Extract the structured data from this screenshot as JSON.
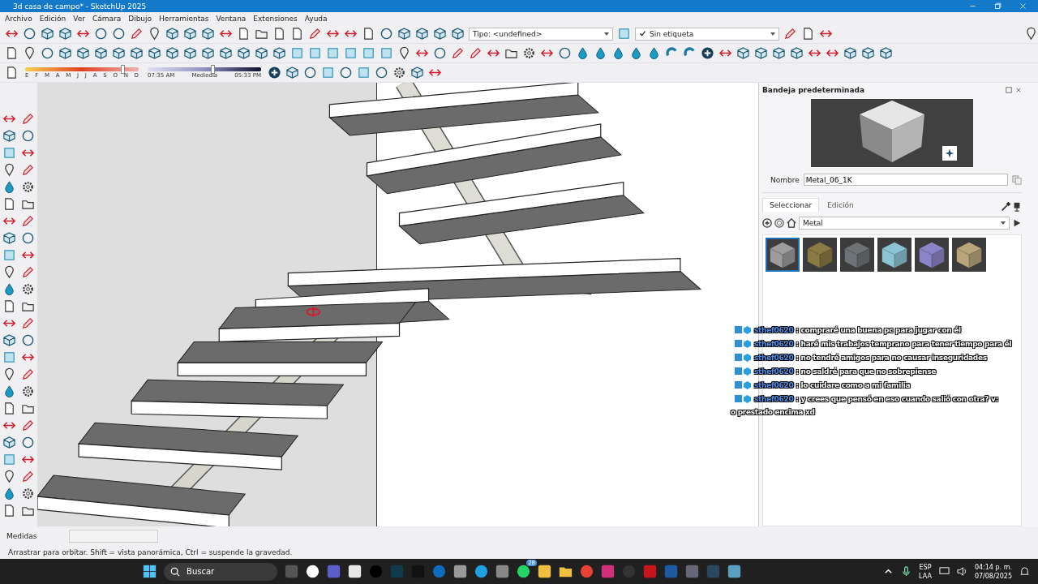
{
  "window": {
    "title": "3d casa de campo* - SketchUp 2025"
  },
  "menu": [
    "Archivo",
    "Edición",
    "Ver",
    "Cámara",
    "Dibujo",
    "Herramientas",
    "Ventana",
    "Extensiones",
    "Ayuda"
  ],
  "toolbar": {
    "type_dropdown": "Tipo: <undefined>",
    "tag_dropdown": "Sin etiqueta"
  },
  "shadows": {
    "months": [
      "E",
      "F",
      "M",
      "A",
      "M",
      "J",
      "J",
      "A",
      "S",
      "O",
      "N",
      "D"
    ],
    "month_slider": {
      "level": 0.86
    },
    "times": [
      "07:35 AM",
      "Mediodia",
      "05:33 PM"
    ],
    "time_slider": {
      "level": 0.57
    }
  },
  "chat": {
    "messages": [
      {
        "user": "sthef0620",
        "text": ": compraré una buena pc para jugar con él"
      },
      {
        "user": "sthef0620",
        "text": ": haré mis trabajos temprano para tener tiempo para él"
      },
      {
        "user": "sthef0620",
        "text": ": no tendré amigos para no causar inseguridades"
      },
      {
        "user": "sthef0620",
        "text": ": no saldré para que no sobrepiense"
      },
      {
        "user": "sthef0620",
        "text": ": lo cuidare como a mi familia"
      },
      {
        "user": "sthef0620",
        "text": ": y crees que pensó en eso cuando salió con otra? v:"
      }
    ],
    "partial_line": "o prestado encima xd"
  },
  "tray": {
    "title": "Bandeja predeterminada",
    "name_label": "Nombre",
    "name_value": "Metal_06_1K",
    "tabs": [
      {
        "label": "Seleccionar",
        "selected": true
      },
      {
        "label": "Edición",
        "selected": false
      }
    ],
    "library": "Metal",
    "materials": [
      {
        "color": "#9c9c9c",
        "selected": true
      },
      {
        "color": "#8a7a45",
        "selected": false
      },
      {
        "color": "#6d7377",
        "selected": false
      },
      {
        "color": "#8cc4d4",
        "selected": false
      },
      {
        "color": "#8c84c8",
        "selected": false
      },
      {
        "color": "#b8a57c",
        "selected": false
      }
    ]
  },
  "measurements": {
    "label": "Medidas"
  },
  "status_bar": "Arrastrar para orbitar. Shift = vista panorámica, Ctrl = suspende la gravedad.",
  "taskbar": {
    "search_placeholder": "Buscar",
    "badge": "28",
    "language": [
      "ESP",
      "LAA"
    ],
    "time": "04:14 p. m.",
    "date": "07/08/2025"
  }
}
